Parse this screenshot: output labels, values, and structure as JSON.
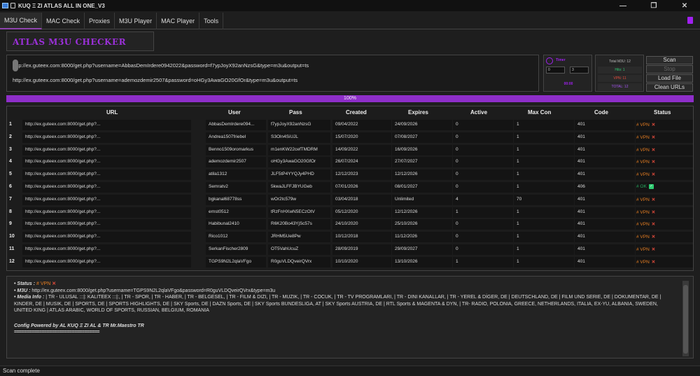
{
  "window": {
    "title": "KUQ Ξ ZI  ATLAS ALL IN ONE_V3",
    "controls": [
      "—",
      "❐",
      "✕"
    ]
  },
  "tabs": [
    "M3U Check",
    "MAC Check",
    "Proxies",
    "M3U Player",
    "MAC Player",
    "Tools"
  ],
  "banner": "ATLAS M3U CHECKER",
  "url_input": [
    "http://ex.guteex.com:8000/get.php?username=AbbasDemIrdere0942022&password=f7ypJoyX92anNzsG&type=m3u&output=ts",
    "http://ex.guteex.com:8000/get.php?username=ademozdemir2507&password=oHGy3AwaGO20GfOr&type=m3u&output=ts"
  ],
  "timer": {
    "label": "Timer",
    "value1": "0",
    "value2": "3",
    "display": "00:00"
  },
  "stats": {
    "total": "Total M3U: 12",
    "hits": "Hits: 1",
    "vpn": "VPN: 11",
    "total2": "TOTAL: 12"
  },
  "buttons": {
    "scan": "Scan",
    "stop": "Stop",
    "load": "Load File",
    "clean": "Clean URLs"
  },
  "progress": {
    "label": "100%",
    "value": 100
  },
  "table": {
    "headers": [
      "URL",
      "User",
      "Pass",
      "Created",
      "Expires",
      "Active",
      "Max Con",
      "Code",
      "Status"
    ],
    "rows": [
      {
        "n": "1",
        "url": "http://ex.guteex.com:8000/get.php?...",
        "user": "AbbasDemIrdere094...",
        "pass": "f7ypJoyX92anNzsG",
        "created": "09/04/2022",
        "expires": "24/09/2026",
        "active": "0",
        "max": "1",
        "code": "401",
        "status": "# VPN",
        "ok": false
      },
      {
        "n": "2",
        "url": "http://ex.guteex.com:8000/get.php?...",
        "user": "Andrea1507friebel",
        "pass": "S3Oln4SiUJL",
        "created": "15/07/2020",
        "expires": "07/08/2027",
        "active": "0",
        "max": "1",
        "code": "401",
        "status": "# VPN",
        "ok": false
      },
      {
        "n": "3",
        "url": "http://ex.guteex.com:8000/get.php?...",
        "user": "Benno1509oromarkus",
        "pass": "m1enKW22cefTMDRM",
        "created": "14/09/2022",
        "expires": "16/09/2026",
        "active": "0",
        "max": "1",
        "code": "401",
        "status": "# VPN",
        "ok": false
      },
      {
        "n": "4",
        "url": "http://ex.guteex.com:8000/get.php?...",
        "user": "ademozdemir2507",
        "pass": "oHGy3AwaGO20GfOr",
        "created": "26/07/2024",
        "expires": "27/07/2027",
        "active": "0",
        "max": "1",
        "code": "401",
        "status": "# VPN",
        "ok": false
      },
      {
        "n": "5",
        "url": "http://ex.guteex.com:8000/get.php?...",
        "user": "atila1312",
        "pass": "JLF5tP4YYQJy4PHD",
        "created": "12/12/2023",
        "expires": "12/12/2026",
        "active": "0",
        "max": "1",
        "code": "401",
        "status": "# VPN",
        "ok": false
      },
      {
        "n": "6",
        "url": "http://ex.guteex.com:8000/get.php?...",
        "user": "Semratv2",
        "pass": "5kwaJLFFJBYUGeb",
        "created": "07/01/2026",
        "expires": "08/01/2027",
        "active": "0",
        "max": "1",
        "code": "406",
        "status": "# OK",
        "ok": true
      },
      {
        "n": "7",
        "url": "http://ex.guteex.com:8000/get.php?...",
        "user": "bgkanal68778ss",
        "pass": "wOr2tc579w",
        "created": "03/04/2018",
        "expires": "Unlimited",
        "active": "4",
        "max": "70",
        "code": "401",
        "status": "# VPN",
        "ok": false
      },
      {
        "n": "8",
        "url": "http://ex.guteex.com:8000/get.php?...",
        "user": "ernst0512",
        "pass": "tRzFnHXwN5ECzOtV",
        "created": "05/12/2020",
        "expires": "12/12/2026",
        "active": "1",
        "max": "1",
        "code": "401",
        "status": "# VPN",
        "ok": false
      },
      {
        "n": "9",
        "url": "http://ex.guteex.com:8000/get.php?...",
        "user": "Habibunal2410",
        "pass": "R6K20Bo43YjSc57s",
        "created": "24/10/2020",
        "expires": "25/10/2026",
        "active": "0",
        "max": "1",
        "code": "401",
        "status": "# VPN",
        "ok": false
      },
      {
        "n": "10",
        "url": "http://ex.guteex.com:8000/get.php?...",
        "user": "Rico1012",
        "pass": "JRHM5Ue8Pw",
        "created": "10/12/2018",
        "expires": "11/12/2026",
        "active": "0",
        "max": "1",
        "code": "401",
        "status": "# VPN",
        "ok": false
      },
      {
        "n": "11",
        "url": "http://ex.guteex.com:8000/get.php?...",
        "user": "SerkanFischer2809",
        "pass": "OT5VahUcuZ",
        "created": "28/09/2019",
        "expires": "29/09/2027",
        "active": "0",
        "max": "1",
        "code": "401",
        "status": "# VPN",
        "ok": false
      },
      {
        "n": "12",
        "url": "http://ex.guteex.com:8000/get.php?...",
        "user": "TGPS9N2L2qlaVFgo",
        "pass": "R0guVLDQveirQVrx",
        "created": "10/10/2020",
        "expires": "13/10/2026",
        "active": "1",
        "max": "1",
        "code": "401",
        "status": "# VPN",
        "ok": false
      }
    ]
  },
  "info": {
    "status_label": "• Status :",
    "status_value": "# VPN",
    "m3u_label": "• M3U :",
    "m3u_value": "http://ex.guteex.com:8000/get.php?username=TGPS9N2L2qlaVFgo&password=R0guVLDQveirQVrx&type=m3u",
    "media_label": "• Media Info :",
    "media_value": "| TR - ULUSAL :::|: KALITEEX :::|:, | TR - SPOR, | TR - HABER, | TR - BELGESEL, | TR - FILM & DIZI, | TR - MUZIK, | TR - COCUK, | TR - TV PROGRAMLARI, | TR - DINI KANALLAR, | TR - YEREL & DİGER, DE | DEUTSCHLAND, DE | FILM UND SERIE, DE | DOKUMENTAR, DE | KINDER, DE | MUSIK, DE | SPORTS, DE | SPORTS HIGHLIGHTS, DE | SKY Sports, DE | DAZN Sports, DE | SKY Sports BUNDESLIGA, AT | SKY Sports AUSTRIA, DE | RTL Sports & MAGENTA & DYN, | TR- RADIO, POLONIA, GREECE, NETHERLANDS, ITALIA, EX-YU, ALBANIA, SWEDEN, UNITED KING | ATLAS ARABIC, WORLD OF SPORTS, RUSSIAN, BELGIUM, ROMANIA",
    "config": "Config Powered by AL KUQ Ξ ZI AL & TR Mr.Maestro TR",
    "separator": "=================================="
  },
  "statusbar": "Scan complete",
  "colors": {
    "accent": "#8e2ec9",
    "vpn": "#e67e22",
    "ok": "#27ae60",
    "fail": "#e74c3c"
  }
}
